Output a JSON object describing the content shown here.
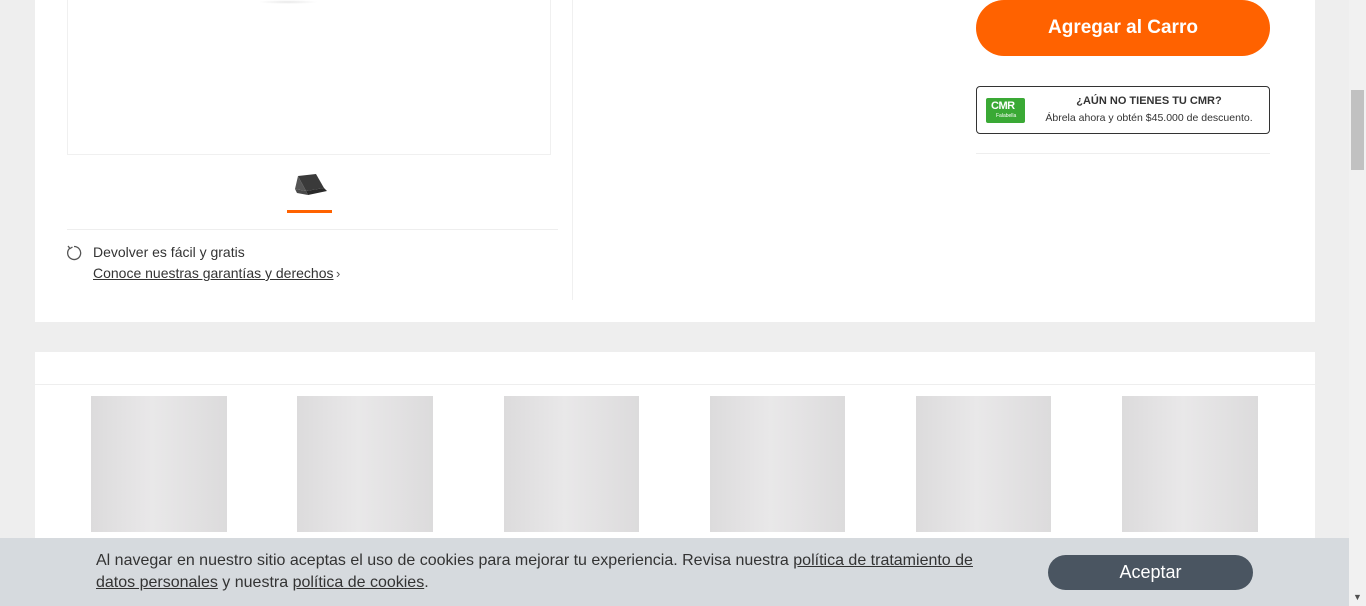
{
  "product": {
    "thumbnail_icon": "laptop-icon",
    "returns_icon": "refresh-icon",
    "returns_title": "Devolver es fácil y gratis",
    "returns_link": "Conoce nuestras garantías y derechos",
    "returns_chevron": "›",
    "add_to_cart_label": "Agregar al Carro"
  },
  "cmr": {
    "logo_text": "CMR",
    "logo_subtext": "Falabella",
    "title": "¿AÚN NO TIENES TU CMR?",
    "subtitle": "Ábrela ahora y obtén $45.000 de descuento."
  },
  "colors": {
    "accent": "#ff6200",
    "cmr_green": "#3aa935",
    "accept_button": "#4a5561",
    "cookie_bar": "#d5d9dd"
  },
  "cookie_banner": {
    "text_before": "Al navegar en nuestro sitio aceptas el uso de cookies para mejorar tu experiencia. Revisa nuestra ",
    "privacy_link": "política de tratamiento de datos personales",
    "text_middle": " y nuestra ",
    "cookies_link": "política de cookies",
    "text_after": ".",
    "accept_label": "Aceptar"
  },
  "scrollbar": {
    "down_arrow": "▼"
  }
}
